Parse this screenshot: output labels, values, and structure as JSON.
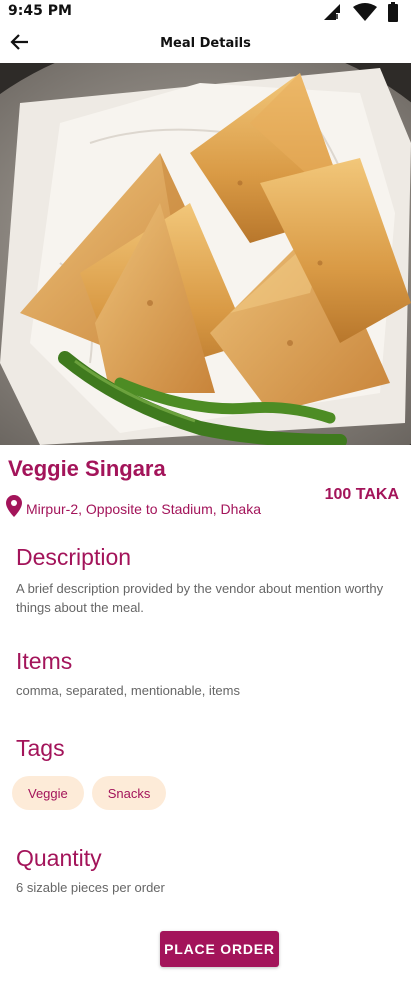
{
  "status_bar": {
    "time": "9:45 PM",
    "icons": [
      "signal-icon",
      "wifi-icon",
      "battery-icon"
    ]
  },
  "app_bar": {
    "title": "Meal Details",
    "back_icon": "arrow-left-icon"
  },
  "hero_image": {
    "subject": "samosas-with-green-chilies-photo"
  },
  "meal": {
    "name": "Veggie Singara",
    "price": "100 TAKA",
    "location": "Mirpur-2, Opposite to Stadium, Dhaka",
    "location_icon": "map-pin-icon"
  },
  "sections": {
    "description": {
      "heading": "Description",
      "body": "A brief description provided by the vendor about mention worthy things about the meal."
    },
    "items": {
      "heading": "Items",
      "body": "comma, separated, mentionable, items"
    },
    "tags": {
      "heading": "Tags",
      "list": [
        "Veggie",
        "Snacks"
      ]
    },
    "quantity": {
      "heading": "Quantity",
      "body": "6 sizable pieces per order"
    }
  },
  "actions": {
    "place_order": "PLACE ORDER"
  },
  "colors": {
    "accent": "#a3145a",
    "chip_bg": "#fdebd8",
    "body_text": "#666666"
  }
}
